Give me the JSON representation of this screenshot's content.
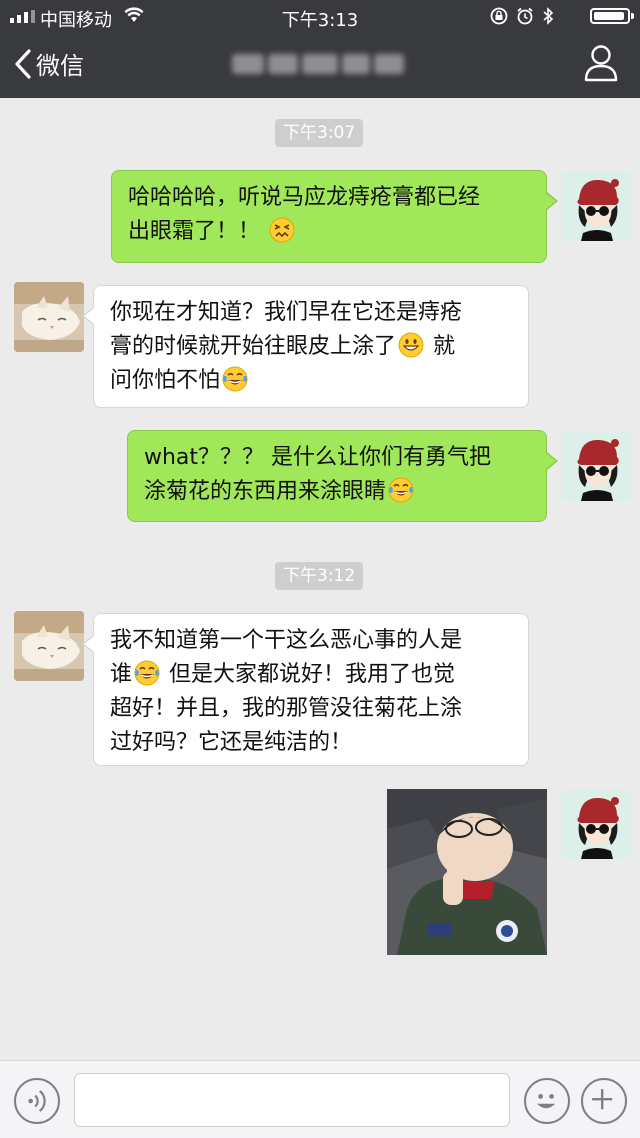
{
  "status_bar": {
    "carrier": "中国移动",
    "time": "下午3:13",
    "battery_level": 0.95
  },
  "nav": {
    "back_label": "微信",
    "title": ""
  },
  "chat": {
    "timestamps": [
      "下午3:07",
      "下午3:12"
    ],
    "messages": [
      {
        "from": "me",
        "text": [
          "哈哈哈哈，听说马应龙痔疮膏都已经",
          "出眼霜了！！"
        ],
        "emoji": "confounded-face"
      },
      {
        "from": "them",
        "text": [
          "你现在才知道？我们早在它还是痔疮",
          "膏的时候就开始往眼皮上涂了",
          " 就",
          "问你怕不怕"
        ],
        "emoji": [
          "grinning-face",
          "tears-of-joy-face"
        ]
      },
      {
        "from": "me",
        "text": [
          "what？？？ 是什么让你们有勇气把",
          "涂菊花的东西用来涂眼睛"
        ],
        "emoji": "tears-of-joy-face"
      },
      {
        "from": "them",
        "text": [
          "我不知道第一个干这么恶心事的人是",
          "谁",
          " 但是大家都说好！我用了也觉",
          "超好！并且，我的那管没往菊花上涂",
          "过好吗？它还是纯洁的！"
        ],
        "emoji": "tears-of-joy-face"
      },
      {
        "from": "me",
        "type": "sticker",
        "sticker": "thumbs-up-kid-sticker"
      }
    ]
  },
  "input_bar": {
    "placeholder": "",
    "voice_icon": "voice-icon",
    "emoji_icon": "emoji-icon",
    "add_icon": "plus-icon"
  },
  "colors": {
    "nav_bg": "#393a3e",
    "chat_bg": "#ebebeb",
    "my_bubble": "#a0e75a",
    "their_bubble": "#ffffff"
  }
}
